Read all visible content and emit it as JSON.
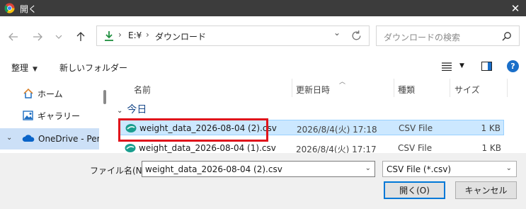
{
  "window": {
    "title": "開く",
    "close_glyph": "✕"
  },
  "address": {
    "crumbs": [
      "E:¥",
      "ダウンロード"
    ],
    "separator": "›",
    "dropdown_glyph": "⌄",
    "search_placeholder": "ダウンロードの検索"
  },
  "toolbar": {
    "organize": "整理",
    "new_folder": "新しいフォルダー"
  },
  "sidebar": {
    "items": [
      {
        "label": "ホーム",
        "icon": "home-icon"
      },
      {
        "label": "ギャラリー",
        "icon": "gallery-icon"
      }
    ],
    "onedrive": {
      "label": "OneDrive - Personal",
      "icon": "cloud-icon"
    }
  },
  "columns": {
    "name": "名前",
    "date": "更新日時",
    "type": "種類",
    "size": "サイズ"
  },
  "group": {
    "label": "今日"
  },
  "files": [
    {
      "name": "weight_data_2026-08-04 (2).csv",
      "date": "2026/8/4(火) 17:18",
      "type": "CSV File",
      "size": "1 KB",
      "selected": true
    },
    {
      "name": "weight_data_2026-08-04 (1).csv",
      "date": "2026/8/4(火) 17:17",
      "type": "CSV File",
      "size": "1 KB",
      "selected": false
    }
  ],
  "bottom": {
    "filename_label": "ファイル名(N):",
    "filename_value": "weight_data_2026-08-04 (2).csv",
    "filetype_value": "CSV File (*.csv)",
    "open_label": "開く(O)",
    "cancel_label": "キャンセル"
  },
  "colors": {
    "accent": "#0078d7",
    "highlight": "#e0141c",
    "selection": "#cce8ff"
  }
}
